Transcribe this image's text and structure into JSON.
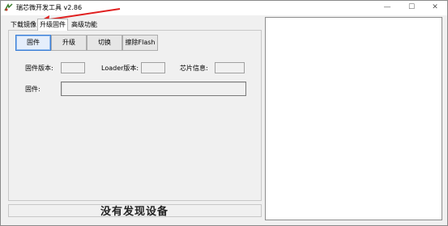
{
  "window": {
    "title": "瑞芯微开发工具 v2.86",
    "controls": {
      "minimize": "—",
      "maximize": "☐",
      "close": "✕"
    }
  },
  "tabs": [
    {
      "label": "下载镜像"
    },
    {
      "label": "升级固件",
      "selected": true
    },
    {
      "label": "高级功能"
    }
  ],
  "toolbar": {
    "buttons": [
      {
        "label": "固件",
        "active": true
      },
      {
        "label": "升级"
      },
      {
        "label": "切换"
      },
      {
        "label": "擦除Flash"
      }
    ]
  },
  "info": {
    "firmware_version_label": "固件版本:",
    "firmware_version_value": "",
    "loader_version_label": "Loader版本:",
    "loader_version_value": "",
    "chip_info_label": "芯片信息:",
    "chip_info_value": "",
    "firmware_label": "固件:",
    "firmware_path": ""
  },
  "status": {
    "message": "没有发现设备"
  },
  "log": {
    "content": ""
  },
  "annotation": {
    "arrow_color": "#e02020"
  }
}
